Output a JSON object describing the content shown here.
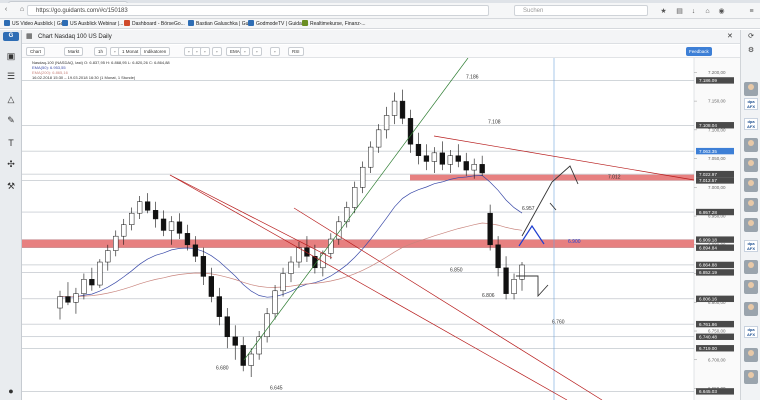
{
  "browser": {
    "url": "https://go.guidants.com/#c/150183",
    "search_placeholder": "Suchen",
    "bookmarks": [
      {
        "label": "US Video Ausblick | Gu...",
        "color": "#2e6db4"
      },
      {
        "label": "US Ausblick Webinar |...",
        "color": "#2e6db4"
      },
      {
        "label": "Dashboard - BörseGo...",
        "color": "#d04a2a"
      },
      {
        "label": "Bastian Galuschka | Gu...",
        "color": "#2e6db4"
      },
      {
        "label": "GodmodeTV | Guidants",
        "color": "#2e6db4"
      },
      {
        "label": "Realtimekurse, Finanz-...",
        "color": "#6b8e23"
      }
    ]
  },
  "app": {
    "title": "Chart Nasdaq 100 US Daily",
    "toolbar": [
      "Chart",
      "Markt",
      "1h",
      "",
      "1 Monat",
      "Indikatoren",
      "",
      "",
      "",
      "",
      "EMA",
      "",
      "",
      "",
      "RSI"
    ],
    "feedback": "Feedback"
  },
  "chart_info": {
    "line1": "Nasdaq-100 (NASDAQ, last)  O: 6.837,95  H: 6.868,95  L: 6.820,26  C: 6.864,88",
    "line2": "EMA(50): 6.953,55",
    "line3": "EMA(200): 6.865,16",
    "line4": "16.02.2018 15:30 – 19.03.2018 16:30   (1 Monat, 1 Stunde)"
  },
  "chart_data": {
    "type": "candlestick",
    "ylim": [
      6630,
      7225
    ],
    "y_ticks": [
      6650,
      6700,
      6750,
      6800,
      6850,
      6900,
      6950,
      7000,
      7050,
      7100,
      7150,
      7200
    ],
    "candles": [
      [
        6790,
        6820,
        6770,
        6810
      ],
      [
        6810,
        6835,
        6795,
        6800
      ],
      [
        6800,
        6825,
        6780,
        6815
      ],
      [
        6815,
        6850,
        6805,
        6840
      ],
      [
        6840,
        6860,
        6820,
        6830
      ],
      [
        6830,
        6875,
        6825,
        6870
      ],
      [
        6870,
        6900,
        6855,
        6890
      ],
      [
        6890,
        6925,
        6880,
        6915
      ],
      [
        6915,
        6945,
        6900,
        6935
      ],
      [
        6935,
        6965,
        6925,
        6955
      ],
      [
        6955,
        6985,
        6945,
        6975
      ],
      [
        6975,
        6990,
        6955,
        6960
      ],
      [
        6960,
        6975,
        6930,
        6945
      ],
      [
        6945,
        6960,
        6915,
        6925
      ],
      [
        6925,
        6950,
        6900,
        6940
      ],
      [
        6940,
        6955,
        6910,
        6920
      ],
      [
        6920,
        6935,
        6890,
        6900
      ],
      [
        6900,
        6915,
        6870,
        6880
      ],
      [
        6880,
        6895,
        6830,
        6845
      ],
      [
        6845,
        6860,
        6800,
        6810
      ],
      [
        6810,
        6825,
        6760,
        6775
      ],
      [
        6775,
        6790,
        6720,
        6740
      ],
      [
        6740,
        6760,
        6700,
        6725
      ],
      [
        6725,
        6740,
        6680,
        6690
      ],
      [
        6690,
        6720,
        6670,
        6710
      ],
      [
        6710,
        6750,
        6700,
        6740
      ],
      [
        6740,
        6790,
        6730,
        6780
      ],
      [
        6780,
        6830,
        6770,
        6820
      ],
      [
        6820,
        6860,
        6810,
        6850
      ],
      [
        6850,
        6880,
        6835,
        6870
      ],
      [
        6870,
        6905,
        6860,
        6895
      ],
      [
        6895,
        6915,
        6870,
        6880
      ],
      [
        6880,
        6900,
        6850,
        6860
      ],
      [
        6860,
        6890,
        6845,
        6885
      ],
      [
        6885,
        6920,
        6875,
        6910
      ],
      [
        6910,
        6950,
        6900,
        6940
      ],
      [
        6940,
        6975,
        6930,
        6965
      ],
      [
        6965,
        7010,
        6955,
        7000
      ],
      [
        7000,
        7045,
        6990,
        7035
      ],
      [
        7035,
        7080,
        7025,
        7070
      ],
      [
        7070,
        7110,
        7060,
        7100
      ],
      [
        7100,
        7140,
        7085,
        7125
      ],
      [
        7125,
        7165,
        7110,
        7150
      ],
      [
        7150,
        7170,
        7110,
        7120
      ],
      [
        7120,
        7135,
        7060,
        7075
      ],
      [
        7075,
        7095,
        7040,
        7055
      ],
      [
        7055,
        7075,
        7030,
        7045
      ],
      [
        7045,
        7070,
        7025,
        7060
      ],
      [
        7060,
        7080,
        7030,
        7040
      ],
      [
        7040,
        7065,
        7025,
        7055
      ],
      [
        7055,
        7075,
        7035,
        7045
      ],
      [
        7045,
        7060,
        7020,
        7030
      ],
      [
        7030,
        7050,
        7015,
        7040
      ],
      [
        7040,
        7055,
        7020,
        7025
      ],
      [
        6955,
        6970,
        6890,
        6900
      ],
      [
        6900,
        6915,
        6845,
        6860
      ],
      [
        6860,
        6880,
        6805,
        6815
      ],
      [
        6815,
        6850,
        6805,
        6840
      ],
      [
        6840,
        6870,
        6820,
        6864.88
      ]
    ],
    "price_labels": [
      {
        "value": 7186,
        "text": "7.186.09",
        "color": "#4a4a4a"
      },
      {
        "value": 7108,
        "text": "7.108.04",
        "color": "#4a4a4a"
      },
      {
        "value": 7063,
        "text": "7.063.35",
        "color": "#3d7fd6"
      },
      {
        "value": 7023,
        "text": "7.022.97",
        "color": "#4a4a4a"
      },
      {
        "value": 7012,
        "text": "7.012.57",
        "color": "#4a4a4a"
      },
      {
        "value": 6957,
        "text": "6.957.28",
        "color": "#4a4a4a"
      },
      {
        "value": 6909,
        "text": "6.909.18",
        "color": "#4a4a4a"
      },
      {
        "value": 6895,
        "text": "6.894.84",
        "color": "#4a4a4a"
      },
      {
        "value": 6865,
        "text": "6.864.88",
        "color": "#4a4a4a"
      },
      {
        "value": 6852,
        "text": "6.852.19",
        "color": "#4a4a4a"
      },
      {
        "value": 6806,
        "text": "6.806.16",
        "color": "#4a4a4a"
      },
      {
        "value": 6762,
        "text": "6.761.86",
        "color": "#4a4a4a"
      },
      {
        "value": 6740,
        "text": "6.740.48",
        "color": "#4a4a4a"
      },
      {
        "value": 6720,
        "text": "6.719.00",
        "color": "#4a4a4a"
      },
      {
        "value": 6645,
        "text": "6.645.03",
        "color": "#4a4a4a"
      }
    ],
    "annotations": [
      {
        "text": "7.186",
        "value": 7186
      },
      {
        "text": "7.108",
        "value": 7108
      },
      {
        "text": "7.012",
        "value": 7012
      },
      {
        "text": "6.957",
        "value": 6957
      },
      {
        "text": "6.900",
        "value": 6900
      },
      {
        "text": "6.850",
        "value": 6850
      },
      {
        "text": "6.806",
        "value": 6806
      },
      {
        "text": "6.760",
        "value": 6760
      },
      {
        "text": "6.680",
        "value": 6680
      },
      {
        "text": "6.645",
        "value": 6645
      }
    ],
    "resistance_zones": [
      [
        7022,
        7012
      ],
      [
        6909,
        6895
      ]
    ],
    "colors": {
      "up": "#ffffff",
      "down": "#111111",
      "zone": "#e36a6a",
      "trend_red": "#b71c1c",
      "trend_green": "#2e7d32",
      "ema50": "#3a4aa8",
      "ema200": "#c9857e",
      "arrow_blue": "#1e3fd0",
      "arrow_dark": "#333333",
      "crosshair": "#6fa3dd"
    }
  }
}
